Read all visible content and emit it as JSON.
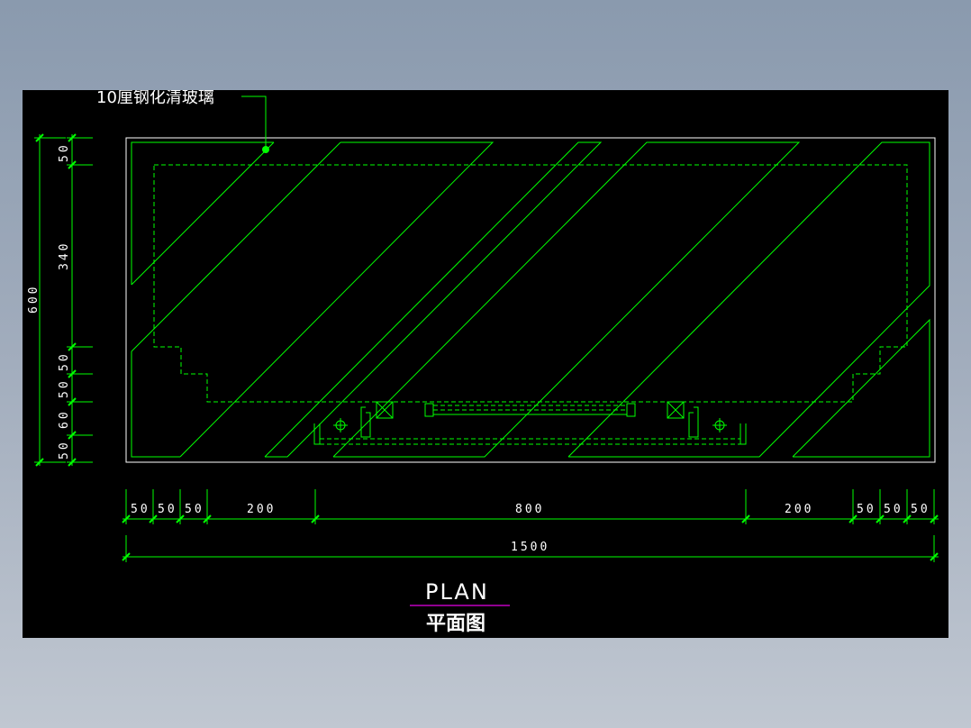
{
  "drawing": {
    "callout_label": "10厘钢化清玻璃",
    "title": "PLAN",
    "subtitle": "平面图",
    "horizontal_dimensions": [
      "50",
      "50",
      "50",
      "200",
      "800",
      "200",
      "50",
      "50",
      "50"
    ],
    "overall_width": "1500",
    "vertical_dimensions": [
      "50",
      "340",
      "50",
      "50",
      "60",
      "50"
    ],
    "overall_height": "600",
    "colors": {
      "background": "#000000",
      "linework": "#00ff00",
      "outline": "#ffffff",
      "title_underline": "#c000c0"
    }
  }
}
